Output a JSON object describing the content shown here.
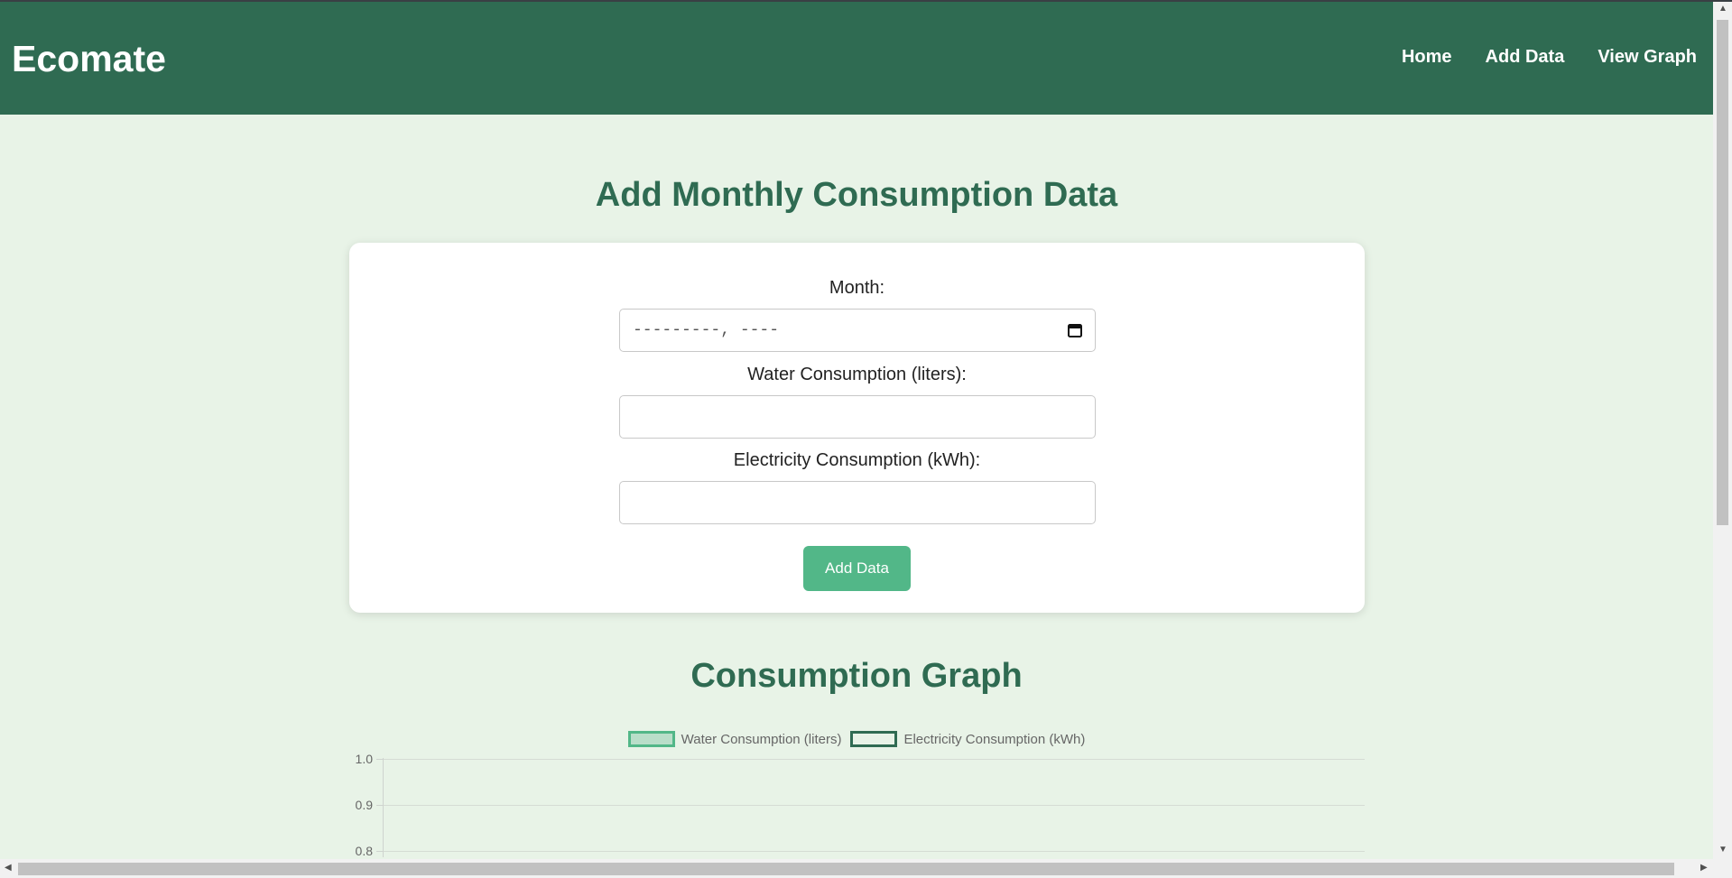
{
  "app": {
    "brand": "Ecomate"
  },
  "nav": {
    "items": [
      {
        "label": "Home"
      },
      {
        "label": "Add Data"
      },
      {
        "label": "View Graph"
      }
    ]
  },
  "form": {
    "title": "Add Monthly Consumption Data",
    "month_label": "Month:",
    "month_value": "---------, ----",
    "water_label": "Water Consumption (liters):",
    "water_value": "",
    "electricity_label": "Electricity Consumption (kWh):",
    "electricity_value": "",
    "submit_label": "Add Data"
  },
  "graph": {
    "title": "Consumption Graph"
  },
  "colors": {
    "brand": "#2f6b52",
    "accent": "#52b788",
    "background": "#e8f3e7"
  },
  "icons": [
    "calendar-icon"
  ],
  "chart_data": {
    "type": "bar",
    "categories": [],
    "series": [
      {
        "name": "Water Consumption (liters)",
        "values": []
      },
      {
        "name": "Electricity Consumption (kWh)",
        "values": []
      }
    ],
    "yticks": [
      "1.0",
      "0.9",
      "0.8"
    ],
    "legend": "top-center",
    "grid": true
  }
}
